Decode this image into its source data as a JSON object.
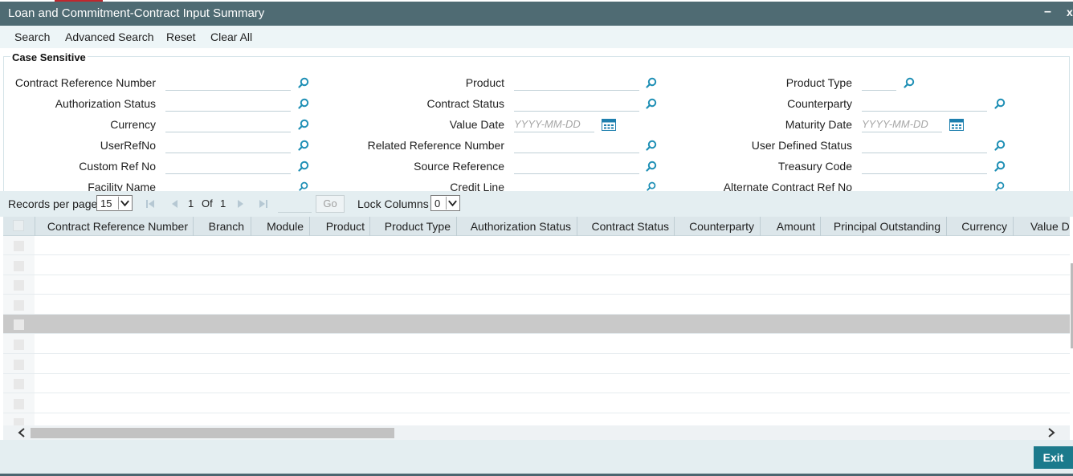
{
  "window": {
    "title": "Loan and Commitment-Contract Input Summary",
    "minimize": "–",
    "close": "x"
  },
  "toolbar": {
    "search": "Search",
    "advanced_search": "Advanced Search",
    "reset": "Reset",
    "clear_all": "Clear All"
  },
  "criteria": {
    "legend": "Case Sensitive",
    "fields": {
      "contract_reference_number": "Contract Reference Number",
      "product": "Product",
      "product_type": "Product Type",
      "authorization_status": "Authorization Status",
      "contract_status": "Contract Status",
      "counterparty": "Counterparty",
      "currency": "Currency",
      "value_date": "Value Date",
      "maturity_date": "Maturity Date",
      "user_ref_no": "UserRefNo",
      "related_reference_number": "Related Reference Number",
      "user_defined_status": "User Defined Status",
      "custom_ref_no": "Custom Ref No",
      "source_reference": "Source Reference",
      "treasury_code": "Treasury Code",
      "facility_name": "Facility Name",
      "credit_line": "Credit Line",
      "alternate_contract_ref_no": "Alternate Contract Ref No"
    },
    "date_placeholder": "YYYY-MM-DD"
  },
  "pager": {
    "records_per_page_label": "Records per page",
    "records_per_page_value": "15",
    "current_page": "1",
    "of_label": "Of",
    "total_pages": "1",
    "go_label": "Go",
    "lock_columns_label": "Lock Columns",
    "lock_columns_value": "0"
  },
  "grid": {
    "columns": [
      "Contract Reference Number",
      "Branch",
      "Module",
      "Product",
      "Product Type",
      "Authorization Status",
      "Contract Status",
      "Counterparty",
      "Amount",
      "Principal Outstanding",
      "Currency",
      "Value D"
    ],
    "row_count": 10,
    "selected_row": 4
  },
  "footer": {
    "exit_label": "Exit"
  },
  "colors": {
    "title_bar": "#4f6b73",
    "toolbar_bg": "#edf5f7",
    "accent_button": "#1b7a8c",
    "lookup_icon": "#1e8fb5"
  },
  "icons": [
    "search-lookup-icon",
    "calendar-icon",
    "first-page-icon",
    "previous-page-icon",
    "next-page-icon",
    "last-page-icon",
    "chevron-down-icon",
    "scroll-left-icon",
    "scroll-right-icon"
  ]
}
